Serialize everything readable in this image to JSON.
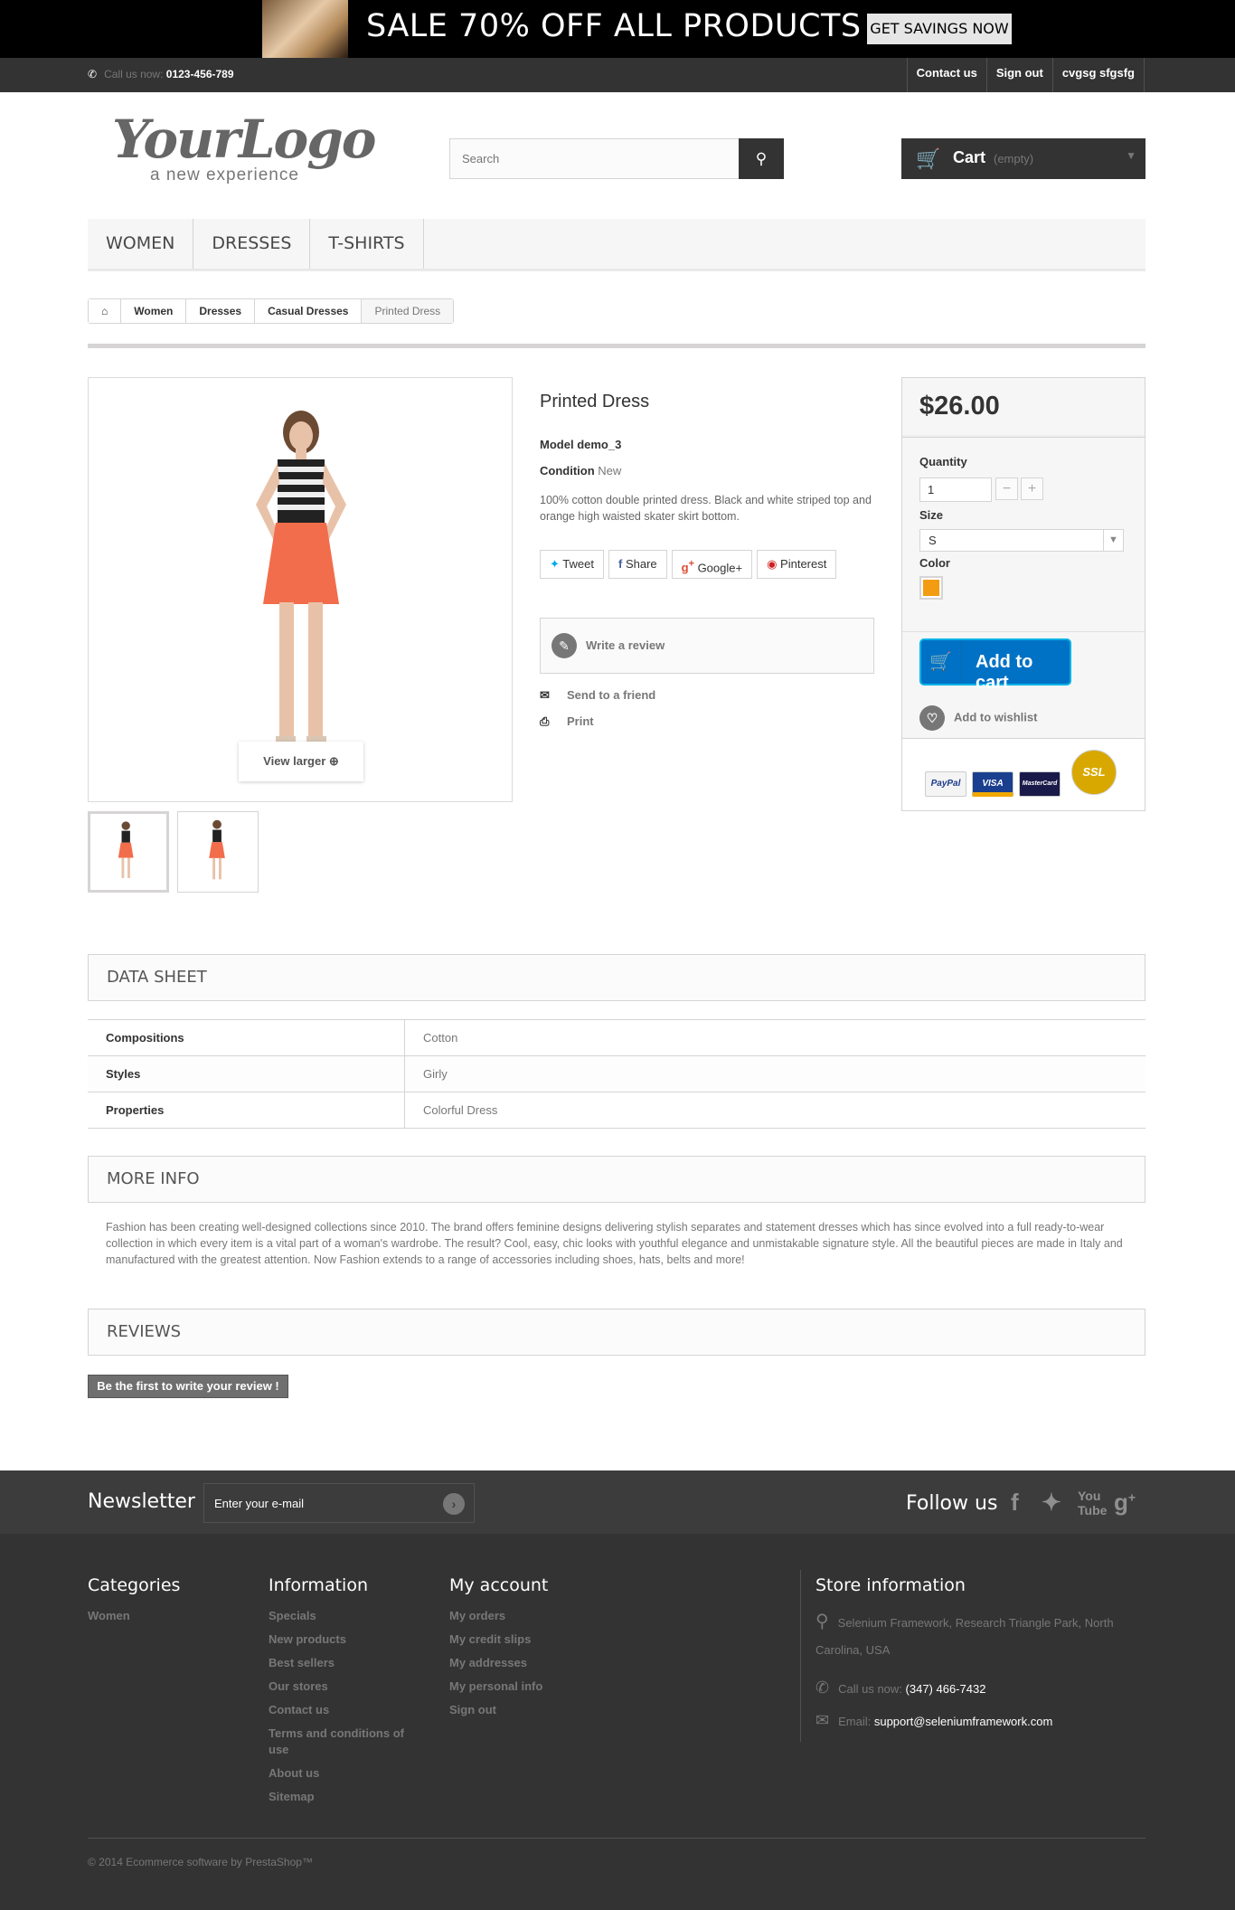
{
  "banner": {
    "sale_text": "SALE 70% OFF ALL PRODUCTS",
    "cta": "GET SAVINGS NOW"
  },
  "topbar": {
    "call_label": "Call us now:",
    "phone": "0123-456-789",
    "links": [
      "Contact us",
      "Sign out",
      "cvgsg sfgsfg"
    ]
  },
  "header": {
    "logo_text": "YourLogo",
    "logo_tagline": "a new experience",
    "search_placeholder": "Search",
    "cart_label": "Cart",
    "cart_state": "(empty)"
  },
  "menu": [
    "Women",
    "Dresses",
    "T-shirts"
  ],
  "breadcrumb": [
    "Women",
    "Dresses",
    "Casual Dresses",
    "Printed Dress"
  ],
  "product": {
    "name": "Printed Dress",
    "model_label": "Model",
    "model": "demo_3",
    "condition_label": "Condition",
    "condition": "New",
    "description": "100% cotton double printed dress. Black and white striped top and orange high waisted skater skirt bottom.",
    "view_larger": "View larger",
    "share": [
      "Tweet",
      "Share",
      "Google+",
      "Pinterest"
    ],
    "write_review": "Write a review",
    "send_friend": "Send to a friend",
    "print": "Print"
  },
  "buy": {
    "price": "$26.00",
    "quantity_label": "Quantity",
    "quantity": "1",
    "size_label": "Size",
    "size": "S",
    "color_label": "Color",
    "color_hex": "#f39c11",
    "add_to_cart": "Add to cart",
    "wishlist": "Add to wishlist",
    "payments": [
      "PayPal",
      "VISA",
      "MasterCard",
      "SSL"
    ]
  },
  "datasheet": {
    "title": "Data sheet",
    "rows": [
      {
        "k": "Compositions",
        "v": "Cotton"
      },
      {
        "k": "Styles",
        "v": "Girly"
      },
      {
        "k": "Properties",
        "v": "Colorful Dress"
      }
    ]
  },
  "moreinfo": {
    "title": "More info",
    "text": "Fashion has been creating well-designed collections since 2010. The brand offers feminine designs delivering stylish separates and statement dresses which has since evolved into a full ready-to-wear collection in which every item is a vital part of a woman's wardrobe. The result? Cool, easy, chic looks with youthful elegance and unmistakable signature style. All the beautiful pieces are made in Italy and manufactured with the greatest attention. Now Fashion extends to a range of accessories including shoes, hats, belts and more!"
  },
  "reviews": {
    "title": "Reviews",
    "first_button": "Be the first to write your review !"
  },
  "newsletter": {
    "title": "Newsletter",
    "placeholder": "Enter your e-mail",
    "follow": "Follow us"
  },
  "footer": {
    "categories": {
      "title": "Categories",
      "items": [
        "Women"
      ]
    },
    "information": {
      "title": "Information",
      "items": [
        "Specials",
        "New products",
        "Best sellers",
        "Our stores",
        "Contact us",
        "Terms and conditions of use",
        "About us",
        "Sitemap"
      ]
    },
    "account": {
      "title": "My account",
      "items": [
        "My orders",
        "My credit slips",
        "My addresses",
        "My personal info",
        "Sign out"
      ]
    },
    "store": {
      "title": "Store information",
      "address": "Selenium Framework, Research Triangle Park, North Carolina, USA",
      "call_label": "Call us now:",
      "phone": "(347) 466-7432",
      "email_label": "Email:",
      "email": "support@seleniumframework.com"
    },
    "copyright": "© 2014 Ecommerce software by PrestaShop™"
  }
}
